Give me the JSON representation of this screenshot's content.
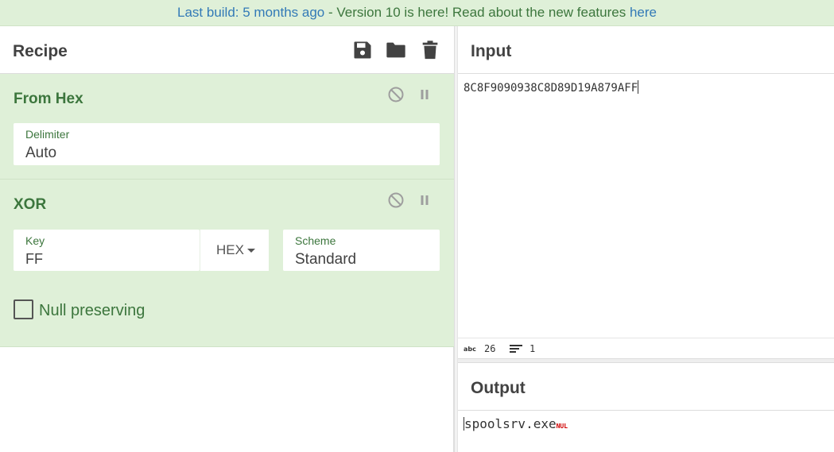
{
  "banner": {
    "prefix": "Last build: 5 months ago",
    "middle": " - Version 10 is here! Read about the new features ",
    "link": "here"
  },
  "recipe": {
    "title": "Recipe",
    "operations": [
      {
        "name": "From Hex",
        "args": [
          {
            "label": "Delimiter",
            "value": "Auto"
          }
        ]
      },
      {
        "name": "XOR",
        "args": [
          {
            "label": "Key",
            "value": "FF",
            "format": "HEX"
          },
          {
            "label": "Scheme",
            "value": "Standard"
          }
        ],
        "checkbox": {
          "label": "Null preserving",
          "checked": false
        }
      }
    ]
  },
  "input": {
    "title": "Input",
    "text": "8C8F9090938C8D89D19A879AFF",
    "stats": {
      "length": "26",
      "lines": "1"
    }
  },
  "output": {
    "title": "Output",
    "text": "spoolsrv.exe",
    "nul_marker": "NUL"
  },
  "colors": {
    "operation_bg": "#dff0d8",
    "operation_text": "#3c763d",
    "link": "#337ab7",
    "nul": "#d00000"
  },
  "icons": [
    "save-icon",
    "folder-icon",
    "trash-icon",
    "disable-icon",
    "pause-icon"
  ]
}
